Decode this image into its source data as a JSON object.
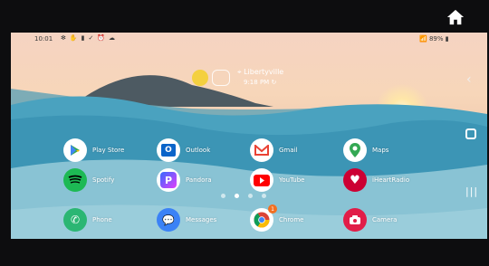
{
  "status": {
    "time": "10:01",
    "battery": "89%"
  },
  "weather": {
    "location": "Libertyville",
    "updated": "9:18 PM"
  },
  "apps": [
    {
      "label": "Play Store"
    },
    {
      "label": "Outlook"
    },
    {
      "label": "Gmail"
    },
    {
      "label": "Maps"
    },
    {
      "label": "Spotify"
    },
    {
      "label": "Pandora"
    },
    {
      "label": "YouTube"
    },
    {
      "label": "iHeartRadio"
    }
  ],
  "dock": [
    {
      "label": "Phone"
    },
    {
      "label": "Messages"
    },
    {
      "label": "Chrome",
      "badge": "1"
    },
    {
      "label": "Camera"
    }
  ],
  "page_indicator": {
    "pages": 4,
    "current": 2
  }
}
